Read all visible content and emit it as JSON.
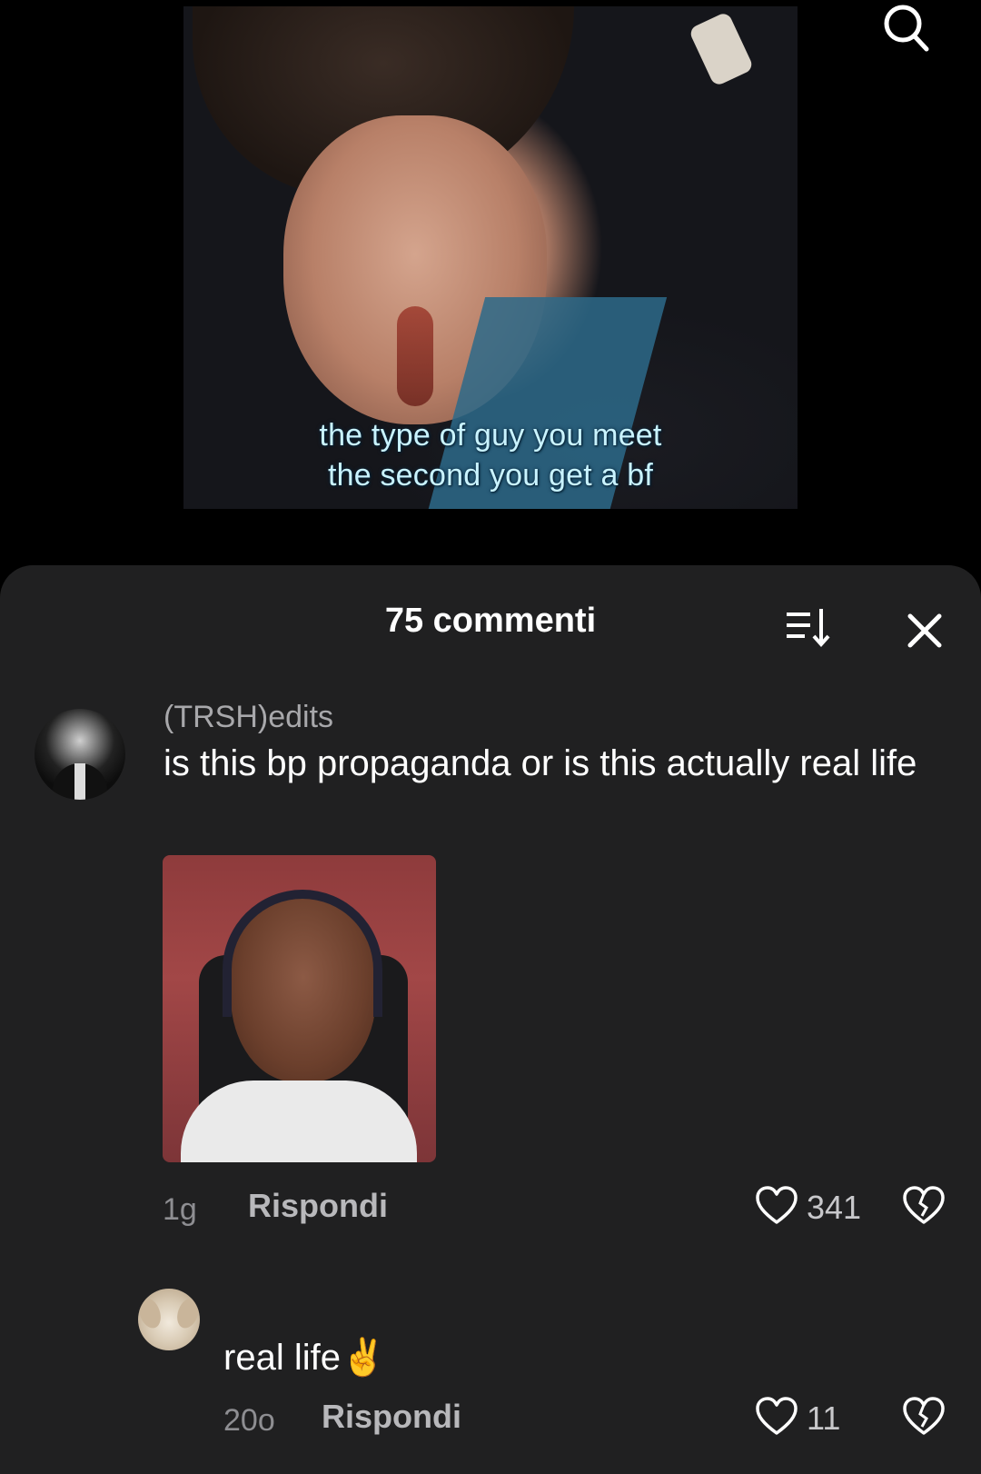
{
  "video": {
    "subtitle_line1": "the type of guy you meet",
    "subtitle_line2": "the second you get a bf"
  },
  "comments_sheet": {
    "title": "75 commenti",
    "comment": {
      "username": "(TRSH)edits",
      "text": "is this bp propaganda or is this actually real life",
      "time": "1g",
      "reply_label": "Rispondi",
      "likes": "341"
    },
    "reply": {
      "text": "real life✌️",
      "time": "20o",
      "reply_label": "Rispondi",
      "likes": "11"
    }
  },
  "icons": {
    "search": "search-icon",
    "sort": "sort-icon",
    "close": "close-icon",
    "like": "heart-icon",
    "dislike": "broken-heart-icon"
  },
  "colors": {
    "sheet_bg": "#202021",
    "page_bg": "#000000",
    "muted_text": "#8e8e92"
  }
}
